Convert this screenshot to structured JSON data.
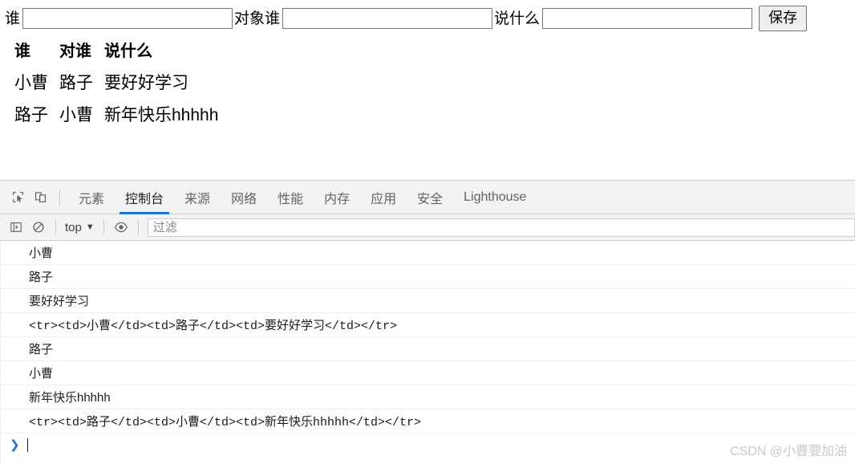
{
  "page": {
    "form": {
      "fields": [
        {
          "label": "谁",
          "value": "",
          "placeholder": ""
        },
        {
          "label": "对象谁",
          "value": "",
          "placeholder": ""
        },
        {
          "label": "说什么",
          "value": "",
          "placeholder": ""
        }
      ],
      "save_label": "保存"
    },
    "table": {
      "headers": [
        "谁",
        "对谁",
        "说什么"
      ],
      "rows": [
        [
          "小曹",
          "路子",
          "要好好学习"
        ],
        [
          "路子",
          "小曹",
          "新年快乐hhhhh"
        ]
      ]
    }
  },
  "devtools": {
    "toolbar_icons": [
      {
        "name": "inspect-element-icon"
      },
      {
        "name": "device-toolbar-icon"
      }
    ],
    "tabs": [
      {
        "label": "元素",
        "active": false
      },
      {
        "label": "控制台",
        "active": true
      },
      {
        "label": "来源",
        "active": false
      },
      {
        "label": "网络",
        "active": false
      },
      {
        "label": "性能",
        "active": false
      },
      {
        "label": "内存",
        "active": false
      },
      {
        "label": "应用",
        "active": false
      },
      {
        "label": "安全",
        "active": false
      },
      {
        "label": "Lighthouse",
        "active": false
      }
    ],
    "console_toolbar": {
      "sidebar_toggle_icon": "console-sidebar-icon",
      "clear_icon": "clear-console-icon",
      "context_label": "top",
      "context_caret": "▼",
      "eye_icon": "live-expression-icon",
      "filter_placeholder": "过滤",
      "filter_value": ""
    },
    "console_logs": [
      {
        "text": "小曹",
        "mono": false
      },
      {
        "text": "路子",
        "mono": false
      },
      {
        "text": "要好好学习",
        "mono": false
      },
      {
        "text": "<tr><td>小曹</td><td>路子</td><td>要好好学习</td></tr>",
        "mono": true
      },
      {
        "text": "路子",
        "mono": false
      },
      {
        "text": "小曹",
        "mono": false
      },
      {
        "text": "新年快乐hhhhh",
        "mono": false
      },
      {
        "text": "<tr><td>路子</td><td>小曹</td><td>新年快乐hhhhh</td></tr>",
        "mono": true
      }
    ],
    "prompt": {
      "arrow": "❯",
      "value": ""
    }
  },
  "watermark": "CSDN @小曹要加油",
  "colors": {
    "accent": "#1a73e8",
    "toolbar_bg": "#f3f3f3",
    "border": "#cdcdcd",
    "log_text": "#202124",
    "watermark": "#c9c9c9"
  }
}
